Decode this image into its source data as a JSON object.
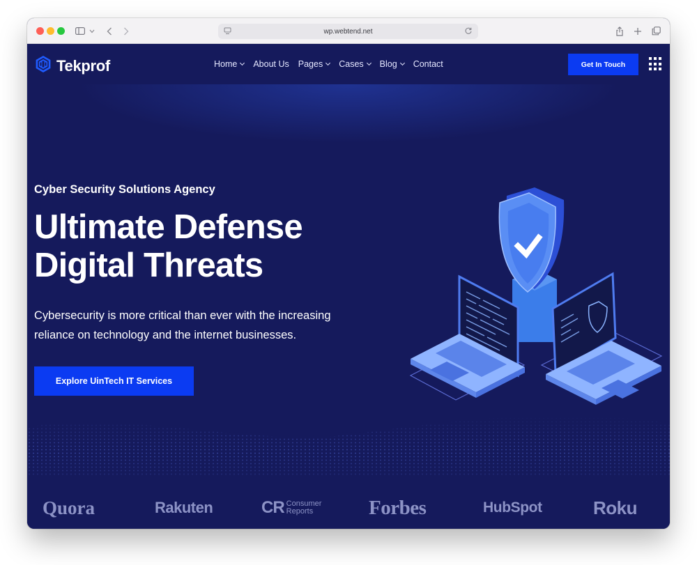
{
  "browser": {
    "url": "wp.webtend.net"
  },
  "site": {
    "logo_text": "Tekprof",
    "nav": [
      {
        "label": "Home",
        "has_dropdown": true
      },
      {
        "label": "About Us",
        "has_dropdown": false
      },
      {
        "label": "Pages",
        "has_dropdown": true
      },
      {
        "label": "Cases",
        "has_dropdown": true
      },
      {
        "label": "Blog",
        "has_dropdown": true
      },
      {
        "label": "Contact",
        "has_dropdown": false
      }
    ],
    "cta_label": "Get In Touch",
    "accent_color": "#0b3bf2",
    "background_color": "#151a5c"
  },
  "hero": {
    "subtitle": "Cyber Security Solutions Agency",
    "title_line1": "Ultimate Defense",
    "title_line2": "Digital Threats",
    "description": "Cybersecurity is more critical than ever with the increasing reliance on technology and the internet businesses.",
    "button_label": "Explore UinTech IT Services"
  },
  "brands": {
    "quora": "Quora",
    "rakuten": "Rakuten",
    "cr_mark": "CR",
    "cr_line1": "Consumer",
    "cr_line2": "Reports",
    "forbes": "Forbes",
    "hubspot": "HubSpot",
    "roku": "Roku"
  },
  "icons": [
    "sidebar-icon",
    "chevron-left-icon",
    "chevron-right-icon",
    "share-icon",
    "plus-icon",
    "tabs-icon",
    "reload-icon",
    "shield-logo-icon",
    "grid-menu-icon"
  ]
}
